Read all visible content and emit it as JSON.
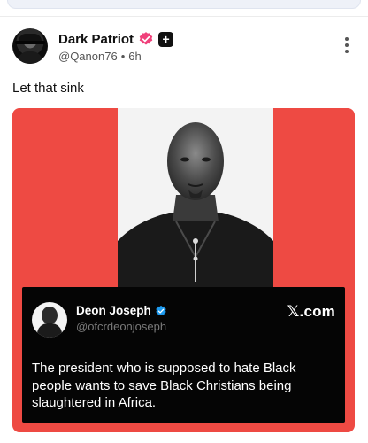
{
  "post": {
    "author": {
      "display_name": "Dark Patriot",
      "handle": "@Qanon76",
      "separator": "•",
      "time": "6h",
      "verified_icon": "verified-badge-icon",
      "plus_label": "+"
    },
    "text": "Let that sink",
    "more_icon": "more-vertical-icon"
  },
  "embedded_tweet": {
    "display_name": "Deon Joseph",
    "handle": "@ofcrdeonjoseph",
    "brand": "𝕏.com",
    "text": "The president who is supposed to hate Black people wants to save Black Christians being slaughtered in Africa."
  },
  "colors": {
    "card_background": "#ee4a43",
    "verified_pink": "#f0407a",
    "verified_blue": "#1d9bf0",
    "tweet_background": "#050505"
  }
}
